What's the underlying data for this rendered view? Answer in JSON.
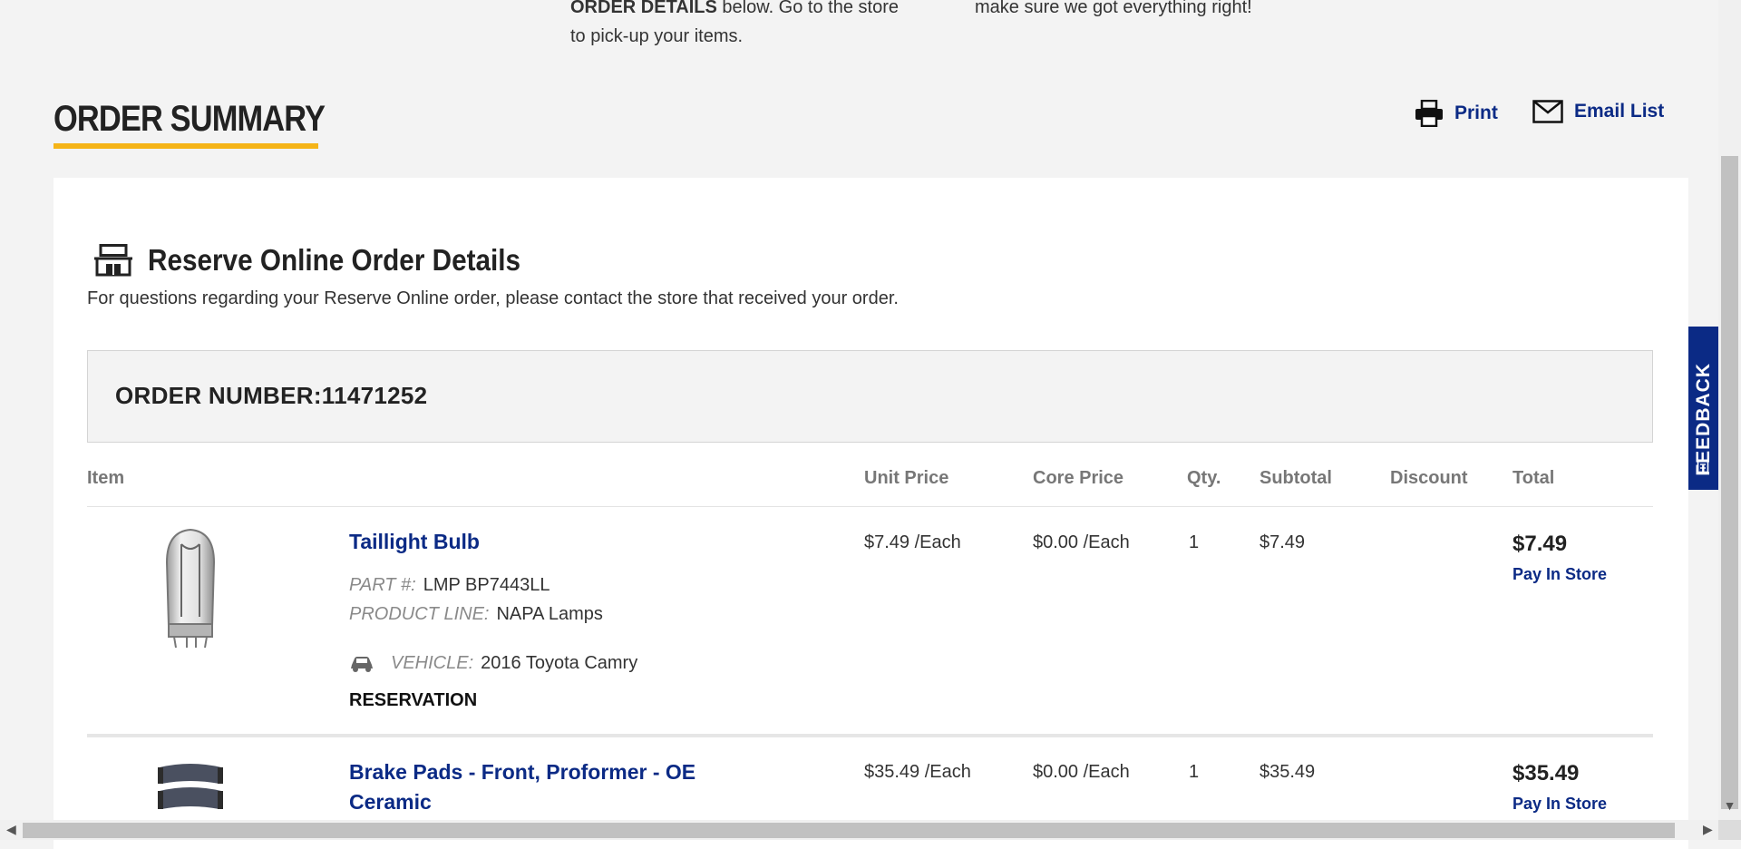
{
  "intro": {
    "left_bold": "ORDER DETAILS",
    "left_rest": " below. Go to the store",
    "left_line2": "to pick-up your items.",
    "right": "make sure we got everything right!"
  },
  "summary": {
    "title": "ORDER SUMMARY"
  },
  "actions": {
    "print_label": "Print",
    "email_label": "Email List"
  },
  "details": {
    "title": "Reserve Online Order Details",
    "description": "For questions regarding your Reserve Online order, please contact the store that received your order."
  },
  "order": {
    "label": "ORDER NUMBER:",
    "number": "11471252"
  },
  "table": {
    "headers": {
      "item": "Item",
      "unit_price": "Unit Price",
      "core_price": "Core Price",
      "qty": "Qty.",
      "subtotal": "Subtotal",
      "discount": "Discount",
      "total": "Total"
    },
    "rows": [
      {
        "name": "Taillight Bulb",
        "part_label": "PART #:",
        "part": "LMP BP7443LL",
        "line_label": "PRODUCT LINE:",
        "line": "NAPA Lamps",
        "vehicle_label": "VEHICLE:",
        "vehicle": "2016 Toyota Camry",
        "type": "RESERVATION",
        "unit_price": "$7.49 /Each",
        "core_price": "$0.00 /Each",
        "qty": "1",
        "subtotal": "$7.49",
        "total": "$7.49",
        "payment": "Pay In Store"
      },
      {
        "name_line1": "Brake Pads - Front, Proformer - OE",
        "name_line2": "Ceramic",
        "unit_price": "$35.49 /Each",
        "core_price": "$0.00 /Each",
        "qty": "1",
        "subtotal": "$35.49",
        "total": "$35.49",
        "payment": "Pay In Store"
      }
    ]
  },
  "feedback": {
    "label": "FEEDBACK"
  },
  "colors": {
    "accent_yellow": "#f5b417",
    "link_blue": "#0b2a85",
    "background": "#f3f3f3"
  }
}
